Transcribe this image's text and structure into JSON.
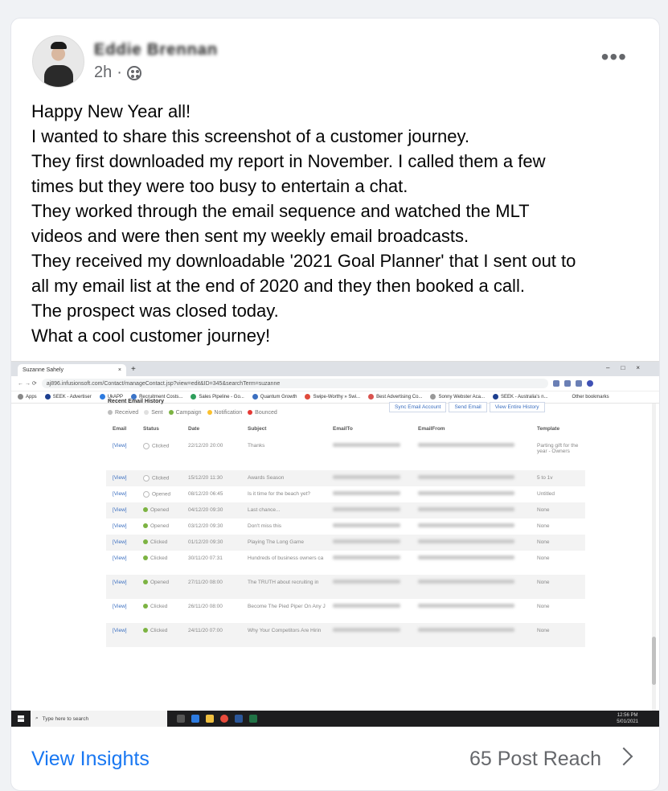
{
  "post": {
    "author": "Eddie Brennan",
    "time": "2h",
    "dot": "·",
    "more": "•••",
    "lines": [
      "Happy New Year all!",
      "I wanted to share this screenshot of a customer journey.",
      "They first downloaded my report in November. I called them a few",
      "times but they were too busy to entertain a chat.",
      "They worked through the email sequence and watched the MLT",
      "videos and were then sent my weekly email broadcasts.",
      "They received my downloadable '2021 Goal Planner' that I sent out to",
      "all my email list at the end of 2020 and they then booked a call.",
      "The prospect was closed today.",
      "What a cool customer journey!"
    ]
  },
  "screenshot": {
    "tab_title": "Suzanne Sahely",
    "tab_close": "×",
    "new_tab": "+",
    "url": "aj896.infusionsoft.com/Contact/manageContact.jsp?view=edit&ID=345&searchTerm=suzanne",
    "bookmarks": [
      "Apps",
      "SEEK - Advertiser",
      "UkAPP",
      "Recruitment Costs...",
      "Sales Pipeline - Go...",
      "Quantum Growth",
      "Swipe-Worthy » Swi...",
      "Best Advertising Co...",
      "Sonny Webster Aca...",
      "SEEK - Australia's n..."
    ],
    "other_bookmarks": "Other bookmarks",
    "section_title": "Recent Email History",
    "legend": [
      {
        "label": "Received",
        "color": "#bdbdbd"
      },
      {
        "label": "Sent",
        "color": "#e0e0e0"
      },
      {
        "label": "Campaign",
        "color": "#7cb342"
      },
      {
        "label": "Notification",
        "color": "#fbc02d"
      },
      {
        "label": "Bounced",
        "color": "#e53935"
      }
    ],
    "buttons": [
      "Sync Email Account",
      "Send Email",
      "View Entire History"
    ],
    "columns": [
      "Email",
      "Status",
      "Date",
      "Subject",
      "EmailTo",
      "EmailFrom",
      "Template"
    ],
    "rows": [
      {
        "link": "[View]",
        "status": "Clicked",
        "campaign": false,
        "date": "22/12/20 20:00",
        "subject": "Thanks",
        "template": "Parting gift for the year - Owners"
      },
      {
        "link": "[View]",
        "status": "Clicked",
        "campaign": false,
        "date": "15/12/20 11:30",
        "subject": "Awards Season",
        "template": "5 to 1v"
      },
      {
        "link": "[View]",
        "status": "Opened",
        "campaign": false,
        "date": "08/12/20 06:45",
        "subject": "Is it time for the beach yet?",
        "template": "Untitled"
      },
      {
        "link": "[View]",
        "status": "Opened",
        "campaign": true,
        "date": "04/12/20 09:30",
        "subject": "Last chance...",
        "template": "None"
      },
      {
        "link": "[View]",
        "status": "Opened",
        "campaign": true,
        "date": "03/12/20 09:30",
        "subject": "Don't miss this",
        "template": "None"
      },
      {
        "link": "[View]",
        "status": "Clicked",
        "campaign": true,
        "date": "01/12/20 09:30",
        "subject": "Playing The Long Game",
        "template": "None"
      },
      {
        "link": "[View]",
        "status": "Clicked",
        "campaign": true,
        "date": "30/11/20 07:31",
        "subject": "Hundreds of business owners ca",
        "template": "None"
      },
      {
        "link": "[View]",
        "status": "Opened",
        "campaign": true,
        "date": "27/11/20 08:00",
        "subject": "The TRUTH about recruiting in",
        "template": "None"
      },
      {
        "link": "[View]",
        "status": "Clicked",
        "campaign": true,
        "date": "26/11/20 08:00",
        "subject": "Become The Pied Piper On Any J",
        "template": "None"
      },
      {
        "link": "[View]",
        "status": "Clicked",
        "campaign": true,
        "date": "24/11/20 07:00",
        "subject": "Why Your Competitors Are Hirin",
        "template": "None"
      }
    ],
    "taskbar_search": "Type here to search",
    "clock_time": "12:56 PM",
    "clock_date": "5/01/2021"
  },
  "footer": {
    "insights": "View Insights",
    "reach": "65 Post Reach"
  }
}
